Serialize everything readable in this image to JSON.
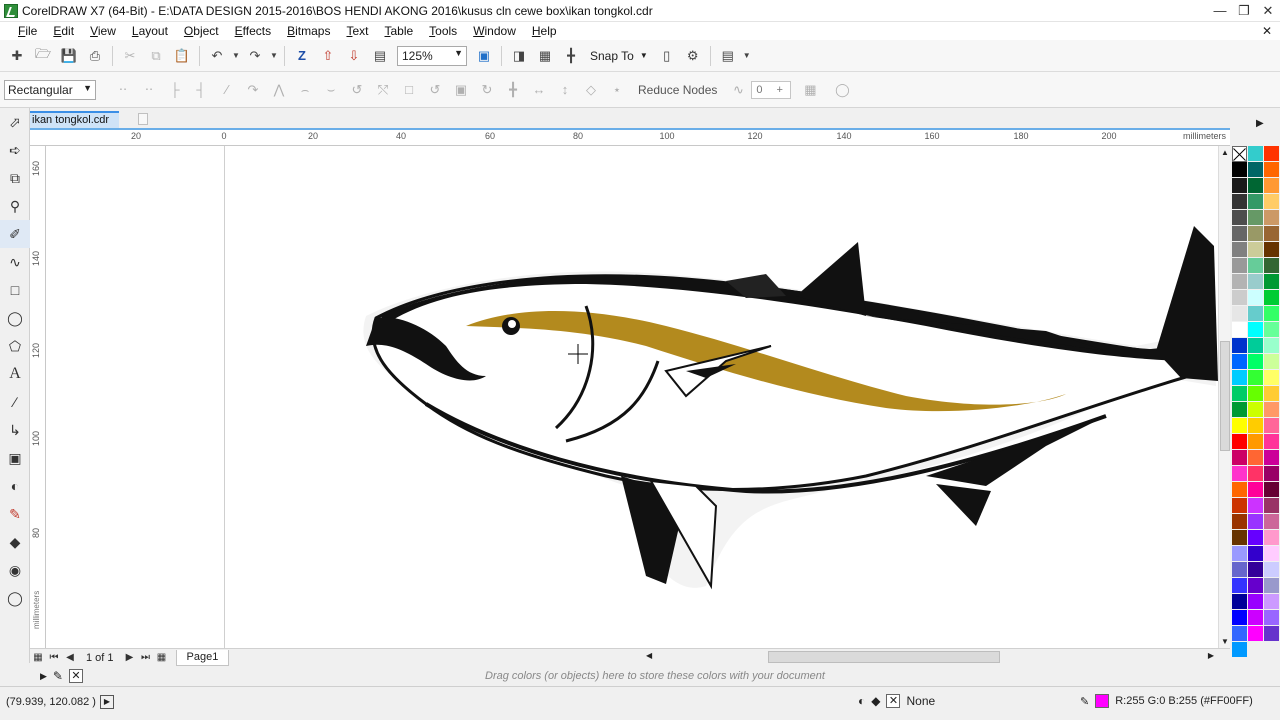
{
  "window": {
    "title": "CorelDRAW X7 (64-Bit) - E:\\DATA DESIGN 2015-2016\\BOS HENDI AKONG 2016\\kusus cln cewe box\\ikan tongkol.cdr"
  },
  "menu": [
    "File",
    "Edit",
    "View",
    "Layout",
    "Object",
    "Effects",
    "Bitmaps",
    "Text",
    "Table",
    "Tools",
    "Window",
    "Help"
  ],
  "toolbar": {
    "zoom": "125%",
    "snap_to": "Snap To"
  },
  "propbar": {
    "selection_mode": "Rectangular",
    "reduce_nodes": "Reduce Nodes",
    "smoothness": "0"
  },
  "document": {
    "tab_label": "ikan tongkol.cdr"
  },
  "ruler": {
    "h_labels": [
      "20",
      "0",
      "20",
      "40",
      "60",
      "80",
      "100",
      "120",
      "140",
      "160",
      "180",
      "200"
    ],
    "unit": "millimeters",
    "v_labels": [
      "160",
      "140",
      "120",
      "100",
      "80"
    ]
  },
  "pages": {
    "count": "1 of 1",
    "current_tab": "Page1"
  },
  "doc_palette": {
    "hint": "Drag colors (or objects) here to store these colors with your document"
  },
  "status": {
    "coords": "(79.939, 120.082 )",
    "fill_label": "None",
    "outline_label": "R:255 G:0 B:255 (#FF00FF)",
    "outline_color": "#FF00FF"
  },
  "palette": {
    "col1": [
      "#000000",
      "#1a1a1a",
      "#333333",
      "#4d4d4d",
      "#666666",
      "#808080",
      "#999999",
      "#b3b3b3",
      "#cccccc",
      "#e6e6e6",
      "#ffffff",
      "#0033cc",
      "#0066ff",
      "#00ccff",
      "#00cc66",
      "#009933",
      "#ffff00",
      "#ff0000",
      "#cc0066",
      "#ff33cc",
      "#ff6600",
      "#cc3300",
      "#993300",
      "#663300",
      "#9999ff",
      "#6666cc",
      "#3333ff",
      "#000099",
      "#0000ff",
      "#3366ff",
      "#0099ff"
    ],
    "col2": [
      "#33cccc",
      "#006666",
      "#006633",
      "#339966",
      "#669966",
      "#999966",
      "#cccc99",
      "#66cc99",
      "#99cccc",
      "#ccffff",
      "#66cccc",
      "#00ffff",
      "#00cc99",
      "#00ff66",
      "#33ff33",
      "#66ff00",
      "#ccff00",
      "#ffcc00",
      "#ff9900",
      "#ff6633",
      "#ff3366",
      "#ff0099",
      "#cc33ff",
      "#9933ff",
      "#6600ff",
      "#3300cc",
      "#330099",
      "#6600cc",
      "#9900ff",
      "#cc00ff",
      "#ff00ff"
    ],
    "col3": [
      "#ff3300",
      "#ff6600",
      "#ff9933",
      "#ffcc66",
      "#cc9966",
      "#996633",
      "#663300",
      "#336633",
      "#009933",
      "#00cc33",
      "#33ff66",
      "#66ff99",
      "#99ffcc",
      "#ccff99",
      "#ffff66",
      "#ffcc33",
      "#ff9966",
      "#ff6699",
      "#ff3399",
      "#cc0099",
      "#990066",
      "#660033",
      "#993366",
      "#cc6699",
      "#ff99cc",
      "#ffccff",
      "#ccccff",
      "#9999cc",
      "#cc99ff",
      "#9966ff",
      "#6633cc"
    ]
  }
}
